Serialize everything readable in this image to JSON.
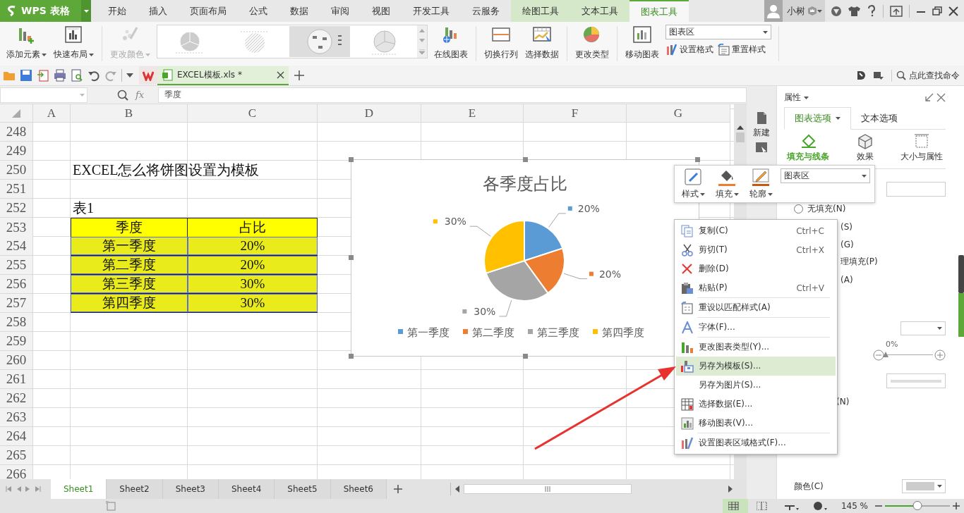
{
  "app_button": {
    "label": "WPS 表格"
  },
  "menu_tabs": [
    {
      "label": "开始",
      "kind": "main",
      "selected": false
    },
    {
      "label": "插入",
      "kind": "main",
      "selected": false
    },
    {
      "label": "页面布局",
      "kind": "main",
      "selected": false
    },
    {
      "label": "公式",
      "kind": "main",
      "selected": false
    },
    {
      "label": "数据",
      "kind": "main",
      "selected": false
    },
    {
      "label": "审阅",
      "kind": "main",
      "selected": false
    },
    {
      "label": "视图",
      "kind": "main",
      "selected": false
    },
    {
      "label": "开发工具",
      "kind": "main",
      "selected": false
    },
    {
      "label": "云服务",
      "kind": "main",
      "selected": false
    },
    {
      "label": "绘图工具",
      "kind": "tool",
      "selected": false
    },
    {
      "label": "文本工具",
      "kind": "tool",
      "selected": false
    },
    {
      "label": "图表工具",
      "kind": "tool",
      "selected": true
    }
  ],
  "account": {
    "user": "小树"
  },
  "ribbon": [
    {
      "kind": "large",
      "label": "添加元素",
      "dropdown": true,
      "disabled": false
    },
    {
      "kind": "large",
      "label": "快速布局",
      "dropdown": true,
      "disabled": false
    },
    {
      "kind": "separator"
    },
    {
      "kind": "large",
      "label": "更改颜色",
      "dropdown": true,
      "disabled": true
    },
    {
      "kind": "gallery"
    },
    {
      "kind": "large",
      "label": "在线图表",
      "dropdown": false,
      "disabled": false
    },
    {
      "kind": "separator"
    },
    {
      "kind": "large",
      "label": "切换行列",
      "dropdown": false,
      "disabled": false
    },
    {
      "kind": "large",
      "label": "选择数据",
      "dropdown": false,
      "disabled": false
    },
    {
      "kind": "separator"
    },
    {
      "kind": "large",
      "label": "更改类型",
      "dropdown": false,
      "disabled": false
    },
    {
      "kind": "separator"
    },
    {
      "kind": "large",
      "label": "移动图表",
      "dropdown": false,
      "disabled": false
    },
    {
      "kind": "stack",
      "select": "图表区",
      "items": [
        {
          "label": "设置格式"
        },
        {
          "label": "重置样式"
        }
      ]
    },
    {
      "kind": "separator"
    }
  ],
  "document_tab": {
    "title": "EXCEL模板.xls *"
  },
  "command_search": {
    "placeholder": "点此查找命令"
  },
  "formula_bar": {
    "function_label": "fx",
    "formula": "季度"
  },
  "sheet": {
    "columns": [
      "A",
      "B",
      "C",
      "D",
      "E",
      "F",
      "G"
    ],
    "rows": [
      {
        "number": "248"
      },
      {
        "number": "249"
      },
      {
        "number": "250",
        "column_b": {
          "kind": "title",
          "text": "EXCEL怎么将饼图设置为模板"
        }
      },
      {
        "number": "251"
      },
      {
        "number": "252",
        "column_b": {
          "kind": "title",
          "text": "表1"
        }
      },
      {
        "number": "253",
        "column_b": {
          "kind": "header",
          "text": "季度",
          "selected": false
        },
        "column_c": {
          "kind": "header",
          "text": "占比",
          "selected": false
        }
      },
      {
        "number": "254",
        "column_b": {
          "kind": "data",
          "text": "第一季度",
          "selected": true
        },
        "column_c": {
          "kind": "data",
          "text": "20%",
          "selected": true
        }
      },
      {
        "number": "255",
        "column_b": {
          "kind": "data",
          "text": "第二季度",
          "selected": true
        },
        "column_c": {
          "kind": "data",
          "text": "20%",
          "selected": true
        }
      },
      {
        "number": "256",
        "column_b": {
          "kind": "data",
          "text": "第三季度",
          "selected": true
        },
        "column_c": {
          "kind": "data",
          "text": "30%",
          "selected": true
        }
      },
      {
        "number": "257",
        "column_b": {
          "kind": "data",
          "text": "第四季度",
          "selected": true
        },
        "column_c": {
          "kind": "data",
          "text": "30%",
          "selected": true
        }
      },
      {
        "number": "258"
      },
      {
        "number": "259"
      },
      {
        "number": "260"
      },
      {
        "number": "261"
      },
      {
        "number": "262"
      },
      {
        "number": "263"
      },
      {
        "number": "264"
      },
      {
        "number": "265"
      },
      {
        "number": "266"
      }
    ]
  },
  "chart": {
    "chart_data": {
      "type": "pie",
      "title": "各季度占比",
      "categories": [
        "第一季度",
        "第二季度",
        "第三季度",
        "第四季度"
      ],
      "values": [
        20,
        20,
        30,
        30
      ],
      "value_labels": [
        "20%",
        "20%",
        "30%",
        "30%"
      ],
      "legend": "bottom"
    }
  },
  "sheet_tabs": [
    {
      "label": "Sheet1",
      "selected": true
    },
    {
      "label": "Sheet2",
      "selected": false
    },
    {
      "label": "Sheet3",
      "selected": false
    },
    {
      "label": "Sheet4",
      "selected": false
    },
    {
      "label": "Sheet5",
      "selected": false
    },
    {
      "label": "Sheet6",
      "selected": false
    }
  ],
  "side_strip": [
    {
      "label": "新建"
    }
  ],
  "panel": {
    "title": "属性",
    "tabs": [
      {
        "label": "图表选项",
        "selected": true
      },
      {
        "label": "文本选项",
        "selected": false
      }
    ],
    "subtabs": [
      {
        "label": "填充与线条",
        "selected": true
      },
      {
        "label": "效果",
        "selected": false
      },
      {
        "label": "大小与属性",
        "selected": false
      }
    ],
    "options": [
      {
        "kind": "field"
      },
      {
        "kind": "radio",
        "label": "无填充(N)",
        "checked": false
      },
      {
        "kind": "partial",
        "label": "(S)"
      },
      {
        "kind": "partial",
        "label": "(G)"
      },
      {
        "kind": "partial",
        "label": "理填充(P)"
      },
      {
        "kind": "partial",
        "label": "(A)"
      },
      {
        "kind": "select"
      },
      {
        "kind": "slider",
        "reading": "0%",
        "level": 0
      },
      {
        "kind": "line-style"
      },
      {
        "kind": "partial",
        "label": "(N)"
      }
    ],
    "color_label": "颜色(C)"
  },
  "mini_toolbar": {
    "buttons": [
      {
        "label": "样式"
      },
      {
        "label": "填充"
      },
      {
        "label": "轮廓"
      }
    ],
    "select": "图表区"
  },
  "context_menu": {
    "groups": [
      [
        {
          "label": "复制(C)",
          "shortcut": "Ctrl+C",
          "selected": false
        },
        {
          "label": "剪切(T)",
          "shortcut": "Ctrl+X",
          "selected": false
        },
        {
          "label": "删除(D)",
          "selected": false
        },
        {
          "label": "粘贴(P)",
          "shortcut": "Ctrl+V",
          "selected": false
        }
      ],
      [
        {
          "label": "重设以匹配样式(A)",
          "selected": false
        }
      ],
      [
        {
          "label": "字体(F)...",
          "selected": false
        }
      ],
      [
        {
          "label": "更改图表类型(Y)...",
          "selected": false
        },
        {
          "label": "另存为模板(S)...",
          "selected": true
        },
        {
          "label": "另存为图片(S)...",
          "selected": false
        },
        {
          "label": "选择数据(E)...",
          "selected": false
        },
        {
          "label": "移动图表(V)...",
          "selected": false
        }
      ],
      [
        {
          "label": "设置图表区域格式(F)...",
          "selected": false
        }
      ]
    ]
  },
  "status_bar": {
    "zoom": {
      "reading": "145 %",
      "level": 0.5
    },
    "views": [
      {
        "selected": true
      },
      {
        "selected": false
      },
      {
        "selected": false
      },
      {
        "selected": false
      }
    ]
  }
}
